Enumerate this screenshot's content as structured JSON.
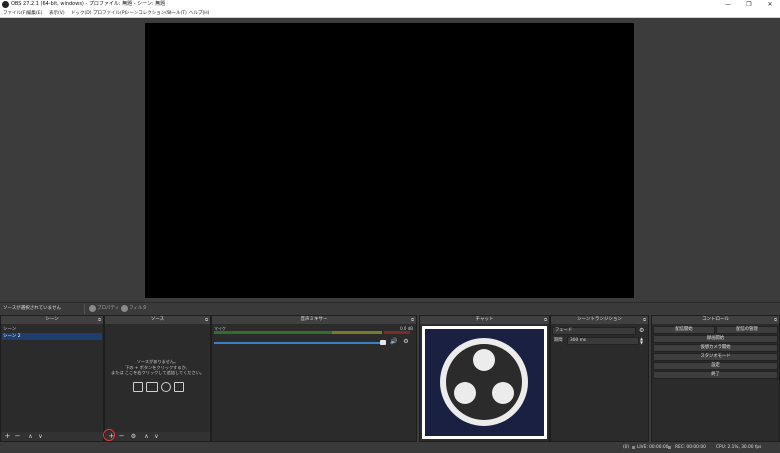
{
  "window": {
    "title": "OBS 27.2.1 (64-bit, windows) - プロファイル: 無題 - シーン: 無題",
    "minimize": "—",
    "maximize": "❐",
    "close": "✕"
  },
  "menu": {
    "items": [
      "ファイル(F)",
      "編集(E)",
      "表示(V)",
      "ドック(D)",
      "プロファイル(P)",
      "シーンコレクション(S)",
      "ツール(T)",
      "ヘルプ(H)"
    ]
  },
  "source_bar": {
    "no_source": "ソースが選択されていません",
    "properties": "プロパティ",
    "filters": "フィルタ"
  },
  "docks": {
    "scenes": {
      "title": "シーン",
      "items": [
        "シーン",
        "シーン 2"
      ],
      "selected_index": 1
    },
    "sources": {
      "title": "ソース",
      "empty_line1": "ソースがありません。",
      "empty_line2": "下の + ボタンをクリックするか、",
      "empty_line3": "または ここを右クリックして追加してください。"
    },
    "mixer": {
      "title": "音声ミキサー",
      "channel": "マイク",
      "db": "0.0 dB",
      "volume_level": 0.98
    },
    "chat": {
      "title": "チャット"
    },
    "transitions": {
      "title": "シーントランジション",
      "type": "フェード",
      "duration_label": "期間",
      "duration_value": "300 ms"
    },
    "controls": {
      "title": "コントロール",
      "start_stream": "配信開始",
      "manage_stream": "配信の管理",
      "start_record": "録画開始",
      "virtual_camera": "仮想カメラ開始",
      "studio_mode": "スタジオモード",
      "settings": "設定",
      "exit": "終了"
    }
  },
  "status": {
    "dropped": "(0)",
    "live": "LIVE: 00:00:00",
    "rec": "REC: 00:00:00",
    "cpu": "CPU: 2.1%, 30.00 fps"
  },
  "icons": {
    "dock_float": "dock-float-icon",
    "add": "plus-icon",
    "remove": "minus-icon",
    "up": "chevron-up-icon",
    "down": "chevron-down-icon",
    "settings": "gear-icon",
    "speaker": "speaker-icon"
  }
}
